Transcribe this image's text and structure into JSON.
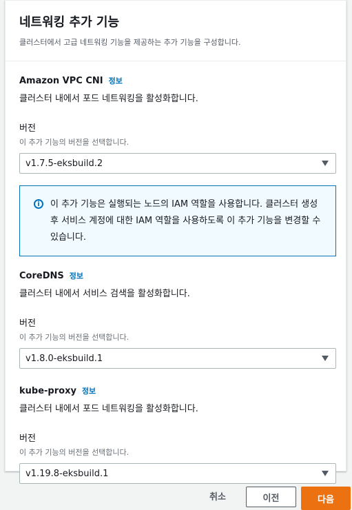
{
  "header": {
    "title": "네트워킹 추가 기능",
    "description": "클러스터에서 고급 네트워킹 기능을 제공하는 추가 기능을 구성합니다."
  },
  "addons": [
    {
      "name": "Amazon VPC CNI",
      "info": "정보",
      "description": "클러스터 내에서 포드 네트워킹을 활성화합니다.",
      "version_label": "버전",
      "version_hint": "이 추가 기능의 버전을 선택합니다.",
      "version": "v1.7.5-eksbuild.2"
    },
    {
      "name": "CoreDNS",
      "info": "정보",
      "description": "클러스터 내에서 서비스 검색을 활성화합니다.",
      "version_label": "버전",
      "version_hint": "이 추가 기능의 버전을 선택합니다.",
      "version": "v1.8.0-eksbuild.1"
    },
    {
      "name": "kube-proxy",
      "info": "정보",
      "description": "클러스터 내에서 포드 네트워킹을 활성화합니다.",
      "version_label": "버전",
      "version_hint": "이 추가 기능의 버전을 선택합니다.",
      "version": "v1.19.8-eksbuild.1"
    }
  ],
  "alert": {
    "icon": "info-icon",
    "text": "이 추가 기능은 실행되는 노드의 IAM 역할을 사용합니다. 클러스터 생성 후 서비스 계정에 대한 IAM 역할을 사용하도록 이 추가 기능을 변경할 수 있습니다."
  },
  "footer": {
    "cancel_label": "취소",
    "previous_label": "이전",
    "next_label": "다음"
  },
  "colors": {
    "link": "#0073bb",
    "primary_button": "#ec7211",
    "alert_border": "#0073bb",
    "alert_background": "#f1faff"
  }
}
